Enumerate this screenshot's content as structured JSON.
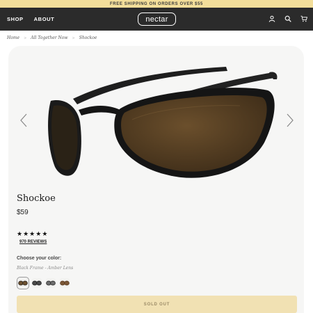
{
  "promo": {
    "text": "FREE SHIPPING ON ORDERS OVER $55"
  },
  "header": {
    "nav": [
      {
        "label": "SHOP"
      },
      {
        "label": "ABOUT"
      }
    ],
    "logo": "nectar",
    "icons": [
      "account-icon",
      "search-icon",
      "cart-icon"
    ]
  },
  "breadcrumb": {
    "items": [
      "Home",
      "All Together Now",
      "Shockoe"
    ],
    "separator": ">"
  },
  "product": {
    "title": "Shockoe",
    "price": "$59",
    "rating": 5,
    "rating_max": 5,
    "reviews": "970 REVIEWS",
    "color_label": "Choose your color:",
    "color_value": "Black Frame - Amber Lens",
    "swatches": [
      {
        "name": "black-amber",
        "frame": "#2a2520",
        "lens": "#6b5030",
        "selected": true
      },
      {
        "name": "black-smoke",
        "frame": "#1c1c1c",
        "lens": "#4a4a4a",
        "selected": false
      },
      {
        "name": "black-grey",
        "frame": "#242424",
        "lens": "#6d6d6d",
        "selected": false
      },
      {
        "name": "tortoise",
        "frame": "#5a3a22",
        "lens": "#7a5635",
        "selected": false
      }
    ],
    "cta": "SOLD OUT"
  },
  "colors": {
    "promo_bg": "#f3de9a",
    "header_bg": "#2b2b2b",
    "card_bg": "#f6f6f5",
    "cta_bg": "#f1e1b3"
  }
}
